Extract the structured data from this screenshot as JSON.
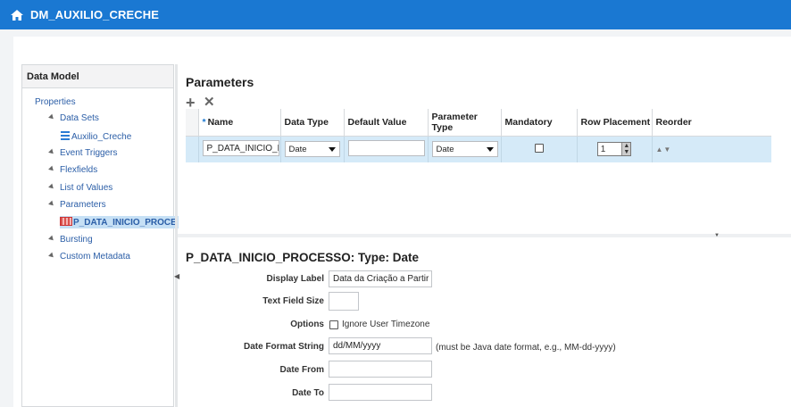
{
  "header": {
    "title": "DM_AUXILIO_CRECHE"
  },
  "left_panel": {
    "title": "Data Model",
    "tree": [
      {
        "label": "Properties"
      },
      {
        "label": "Data Sets"
      },
      {
        "label": "Auxilio_Creche"
      },
      {
        "label": "Event Triggers"
      },
      {
        "label": "Flexfields"
      },
      {
        "label": "List of Values"
      },
      {
        "label": "Parameters"
      },
      {
        "label": "P_DATA_INICIO_PROCE"
      },
      {
        "label": "Bursting"
      },
      {
        "label": "Custom Metadata"
      }
    ]
  },
  "parameters": {
    "title": "Parameters",
    "toolbar": {
      "add": "+",
      "delete": "✕"
    },
    "columns": {
      "required_mark": "*",
      "name": "Name",
      "data_type": "Data Type",
      "default_value": "Default Value",
      "parameter_type": "Parameter Type",
      "mandatory": "Mandatory",
      "row_placement": "Row Placement",
      "reorder": "Reorder"
    },
    "row": {
      "name": "P_DATA_INICIO_P",
      "data_type": "Date",
      "default_value": "",
      "parameter_type": "Date",
      "mandatory": false,
      "row_placement": "1",
      "reorder": "▲▼"
    }
  },
  "detail": {
    "title": "P_DATA_INICIO_PROCESSO: Type: Date",
    "display_label": {
      "label": "Display Label",
      "value": "Data da Criação a Partir De"
    },
    "text_field_size": {
      "label": "Text Field Size",
      "value": ""
    },
    "options": {
      "label": "Options",
      "checkbox_label": "Ignore User Timezone",
      "checked": false
    },
    "date_format": {
      "label": "Date Format String",
      "value": "dd/MM/yyyy",
      "hint": "(must be Java date format, e.g., MM-dd-yyyy)"
    },
    "date_from": {
      "label": "Date From",
      "value": ""
    },
    "date_to": {
      "label": "Date To",
      "value": ""
    }
  },
  "colors": {
    "header_bg": "#1a78d2",
    "selected_row": "#d5eaf8",
    "link": "#2b5ea7"
  }
}
